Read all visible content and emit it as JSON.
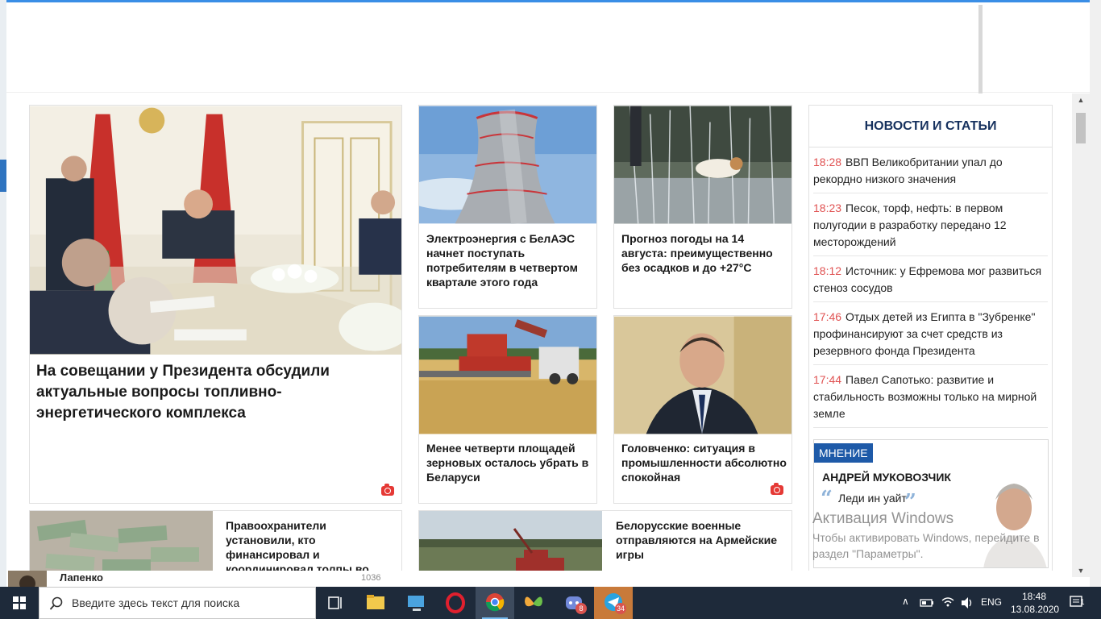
{
  "featured": {
    "headline": "На совещании у Президента обсудили актуальные вопросы топливно-энергетического комплекса"
  },
  "cards": [
    {
      "caption": "Электроэнергия с БелАЭС начнет поступать потребителям в четвертом квартале этого года"
    },
    {
      "caption": "Прогноз погоды на 14 августа: преимущественно без осадков и до +27°С"
    },
    {
      "caption": "Менее четверти площадей зерновых осталось убрать в Беларуси"
    },
    {
      "caption": "Головченко: ситуация в промышленности абсолютно спокойная"
    },
    {
      "caption": "Правоохранители установили, кто финансировал и координировал толпы во"
    },
    {
      "caption": "Белорусские военные отправляются на Армейские игры"
    }
  ],
  "sidebar": {
    "title": "НОВОСТИ И СТАТЬИ",
    "items": [
      {
        "time": "18:28",
        "text": "ВВП Великобритании упал до рекордно низкого значения"
      },
      {
        "time": "18:23",
        "text": "Песок, торф, нефть: в первом полугодии в разработку передано 12 месторождений"
      },
      {
        "time": "18:12",
        "text": "Источник: у Ефремова мог развиться стеноз сосудов"
      },
      {
        "time": "17:46",
        "text": "Отдых детей из Египта в \"Зубренке\" профинансируют за счет средств из резервного фонда Президента"
      },
      {
        "time": "17:44",
        "text": "Павел Сапотько: развитие и стабильность возможны только на мирной земле"
      }
    ],
    "opinion": {
      "tag": "МНЕНИЕ",
      "author": "АНДРЕЙ МУКОВОЗЧИК",
      "quote": "Леди ин уайт"
    }
  },
  "footer_peek": {
    "name": "Лапенко",
    "count": "1036"
  },
  "watermark": {
    "title": "Активация Windows",
    "text": "Чтобы активировать Windows, перейдите в раздел \"Параметры\"."
  },
  "taskbar": {
    "search_placeholder": "Введите здесь текст для поиска",
    "lang": "ENG",
    "time": "18:48",
    "date": "13.08.2020",
    "discord_badge": "8",
    "telegram_badge": "34",
    "notifications": "1"
  },
  "colors": {
    "accent": "#1e5aa8",
    "time": "#e05252",
    "heading": "#16315e",
    "taskbar": "#1e2a3a"
  }
}
